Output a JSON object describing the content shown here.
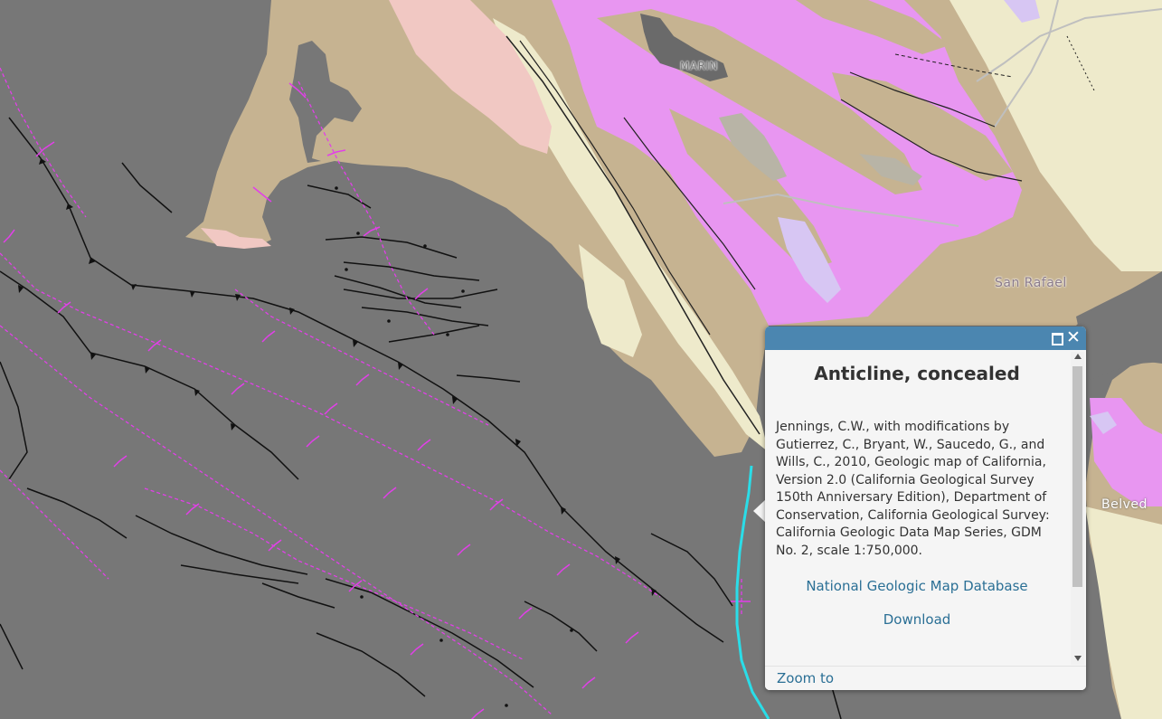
{
  "map": {
    "labels": {
      "marin": "MARIN",
      "san_rafael": "San Rafael",
      "belvedere": "Belved"
    },
    "colors": {
      "ocean": "#777777",
      "terrain_tan": "#c6b391",
      "terrain_cream": "#eeeacb",
      "terrain_pink": "#f1c8c3",
      "terrain_magenta": "#e896f1",
      "terrain_lavender": "#d7c6f3",
      "fault_line": "#111111",
      "anticline_line": "#e23fe9",
      "highlight_line": "#2adde8",
      "popup_header": "#4b86b0"
    }
  },
  "popup": {
    "maximize_icon": "maximize-icon",
    "close_icon": "close-icon",
    "close_glyph": "✕",
    "title": "Anticline, concealed",
    "description": "Jennings, C.W., with modifications by Gutierrez, C., Bryant, W., Saucedo, G., and Wills, C., 2010, Geologic map of California, Version 2.0 (California Geological Survey 150th Anniversary Edition), Department of Conservation, California Geological Survey: California Geologic Data Map Series, GDM No. 2, scale 1:750,000.",
    "link_database": "National Geologic Map Database",
    "link_download": "Download",
    "action_zoom": "Zoom to"
  }
}
